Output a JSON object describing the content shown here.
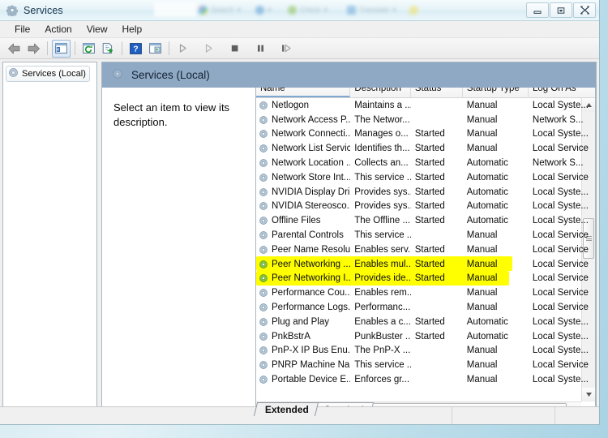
{
  "window": {
    "title": "Services",
    "icon": "services-gear-icon",
    "buttons": {
      "minimize": "Minimize",
      "restore": "Restore",
      "close": "Close"
    },
    "ghost_toolbar": [
      "Search",
      "Check",
      "Translate"
    ]
  },
  "menubar": {
    "items": [
      "File",
      "Action",
      "View",
      "Help"
    ]
  },
  "toolbar": {
    "items": [
      "back-icon",
      "forward-icon",
      "show-hide-console-tree-icon",
      "refresh-icon",
      "export-list-icon",
      "help-icon",
      "properties-icon",
      "start-service-icon",
      "resume-service-icon",
      "stop-service-icon",
      "pause-service-icon",
      "restart-service-icon"
    ]
  },
  "tree": {
    "root_label": "Services (Local)"
  },
  "pane": {
    "header_title": "Services (Local)",
    "description": "Select an item to view its description."
  },
  "list": {
    "columns": [
      "Name",
      "Description",
      "Status",
      "Startup Type",
      "Log On As"
    ],
    "sorted_column": "Name",
    "sort_direction": "ascending",
    "highlight_color": "#ffff00",
    "rows": [
      {
        "name": "Netlogon",
        "description": "Maintains a ...",
        "status": "",
        "startup": "Manual",
        "logon": "Local Syste...",
        "highlighted": false
      },
      {
        "name": "Network Access P...",
        "description": "The Networ...",
        "status": "",
        "startup": "Manual",
        "logon": "Network S...",
        "highlighted": false
      },
      {
        "name": "Network Connecti...",
        "description": "Manages o...",
        "status": "Started",
        "startup": "Manual",
        "logon": "Local Syste...",
        "highlighted": false
      },
      {
        "name": "Network List Service",
        "description": "Identifies th...",
        "status": "Started",
        "startup": "Manual",
        "logon": "Local Service",
        "highlighted": false
      },
      {
        "name": "Network Location ...",
        "description": "Collects an...",
        "status": "Started",
        "startup": "Automatic",
        "logon": "Network S...",
        "highlighted": false
      },
      {
        "name": "Network Store Int...",
        "description": "This service ...",
        "status": "Started",
        "startup": "Automatic",
        "logon": "Local Service",
        "highlighted": false
      },
      {
        "name": "NVIDIA Display Dri...",
        "description": "Provides sys...",
        "status": "Started",
        "startup": "Automatic",
        "logon": "Local Syste...",
        "highlighted": false
      },
      {
        "name": "NVIDIA Stereosco...",
        "description": "Provides sys...",
        "status": "Started",
        "startup": "Automatic",
        "logon": "Local Syste...",
        "highlighted": false
      },
      {
        "name": "Offline Files",
        "description": "The Offline ...",
        "status": "Started",
        "startup": "Automatic",
        "logon": "Local Syste...",
        "highlighted": false
      },
      {
        "name": "Parental Controls",
        "description": "This service ...",
        "status": "",
        "startup": "Manual",
        "logon": "Local Service",
        "highlighted": false
      },
      {
        "name": "Peer Name Resolu...",
        "description": "Enables serv...",
        "status": "Started",
        "startup": "Manual",
        "logon": "Local Service",
        "highlighted": false
      },
      {
        "name": "Peer Networking ...",
        "description": "Enables mul...",
        "status": "Started",
        "startup": "Manual",
        "logon": "Local Service",
        "highlighted": true
      },
      {
        "name": "Peer Networking I...",
        "description": "Provides ide...",
        "status": "Started",
        "startup": "Manual",
        "logon": "Local Service",
        "highlighted": true
      },
      {
        "name": "Performance Cou...",
        "description": "Enables rem...",
        "status": "",
        "startup": "Manual",
        "logon": "Local Service",
        "highlighted": false
      },
      {
        "name": "Performance Logs...",
        "description": "Performanc...",
        "status": "",
        "startup": "Manual",
        "logon": "Local Service",
        "highlighted": false
      },
      {
        "name": "Plug and Play",
        "description": "Enables a c...",
        "status": "Started",
        "startup": "Automatic",
        "logon": "Local Syste...",
        "highlighted": false
      },
      {
        "name": "PnkBstrA",
        "description": "PunkBuster ...",
        "status": "Started",
        "startup": "Automatic",
        "logon": "Local Syste...",
        "highlighted": false
      },
      {
        "name": "PnP-X IP Bus Enu...",
        "description": "The PnP-X ...",
        "status": "",
        "startup": "Manual",
        "logon": "Local Syste...",
        "highlighted": false
      },
      {
        "name": "PNRP Machine Na...",
        "description": "This service ...",
        "status": "",
        "startup": "Manual",
        "logon": "Local Service",
        "highlighted": false
      },
      {
        "name": "Portable Device E...",
        "description": "Enforces gr...",
        "status": "",
        "startup": "Manual",
        "logon": "Local Syste...",
        "highlighted": false
      }
    ]
  },
  "tabs": {
    "items": [
      {
        "label": "Extended",
        "active": true
      },
      {
        "label": "Standard",
        "active": false
      }
    ]
  }
}
